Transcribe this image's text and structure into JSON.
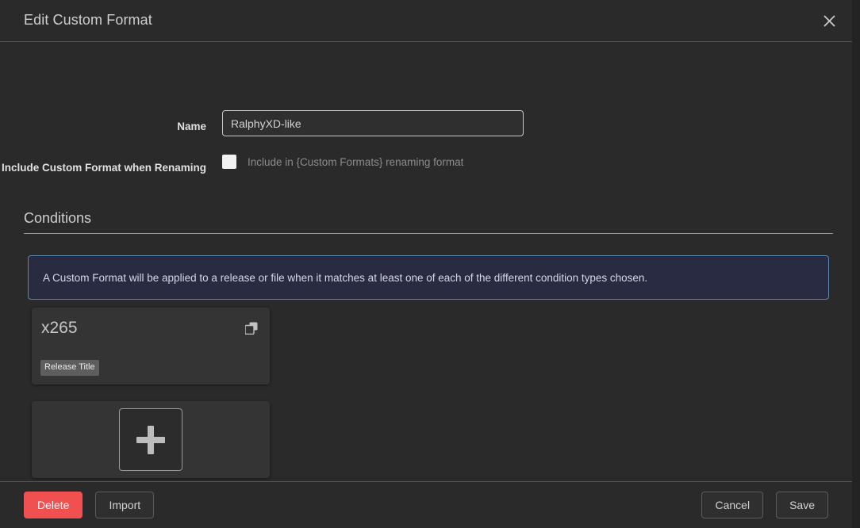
{
  "modal": {
    "title": "Edit Custom Format",
    "close_icon": "close-icon"
  },
  "form": {
    "name": {
      "label": "Name",
      "value": "RalphyXD-like",
      "placeholder": ""
    },
    "include_renaming": {
      "label": "Include Custom Format when Renaming",
      "checkbox_label": "Include in {Custom Formats} renaming format",
      "checked": false
    }
  },
  "conditions": {
    "heading": "Conditions",
    "info_banner": "A Custom Format will be applied to a release or file when it matches at least one of each of the different condition types chosen.",
    "cards": [
      {
        "title": "x265",
        "badge": "Release Title",
        "clone_icon": "clone-icon"
      }
    ],
    "add_button_icon": "plus-icon"
  },
  "footer": {
    "delete_label": "Delete",
    "import_label": "Import",
    "cancel_label": "Cancel",
    "save_label": "Save"
  },
  "colors": {
    "modal_background": "#2a2a2a",
    "card_background": "#343434",
    "banner_background": "#292b42",
    "banner_border": "#5b87ad",
    "danger": "#f05050",
    "badge": "#5d5d5d",
    "text_primary": "#cfcfcf",
    "text_muted": "#8c8c8c"
  }
}
